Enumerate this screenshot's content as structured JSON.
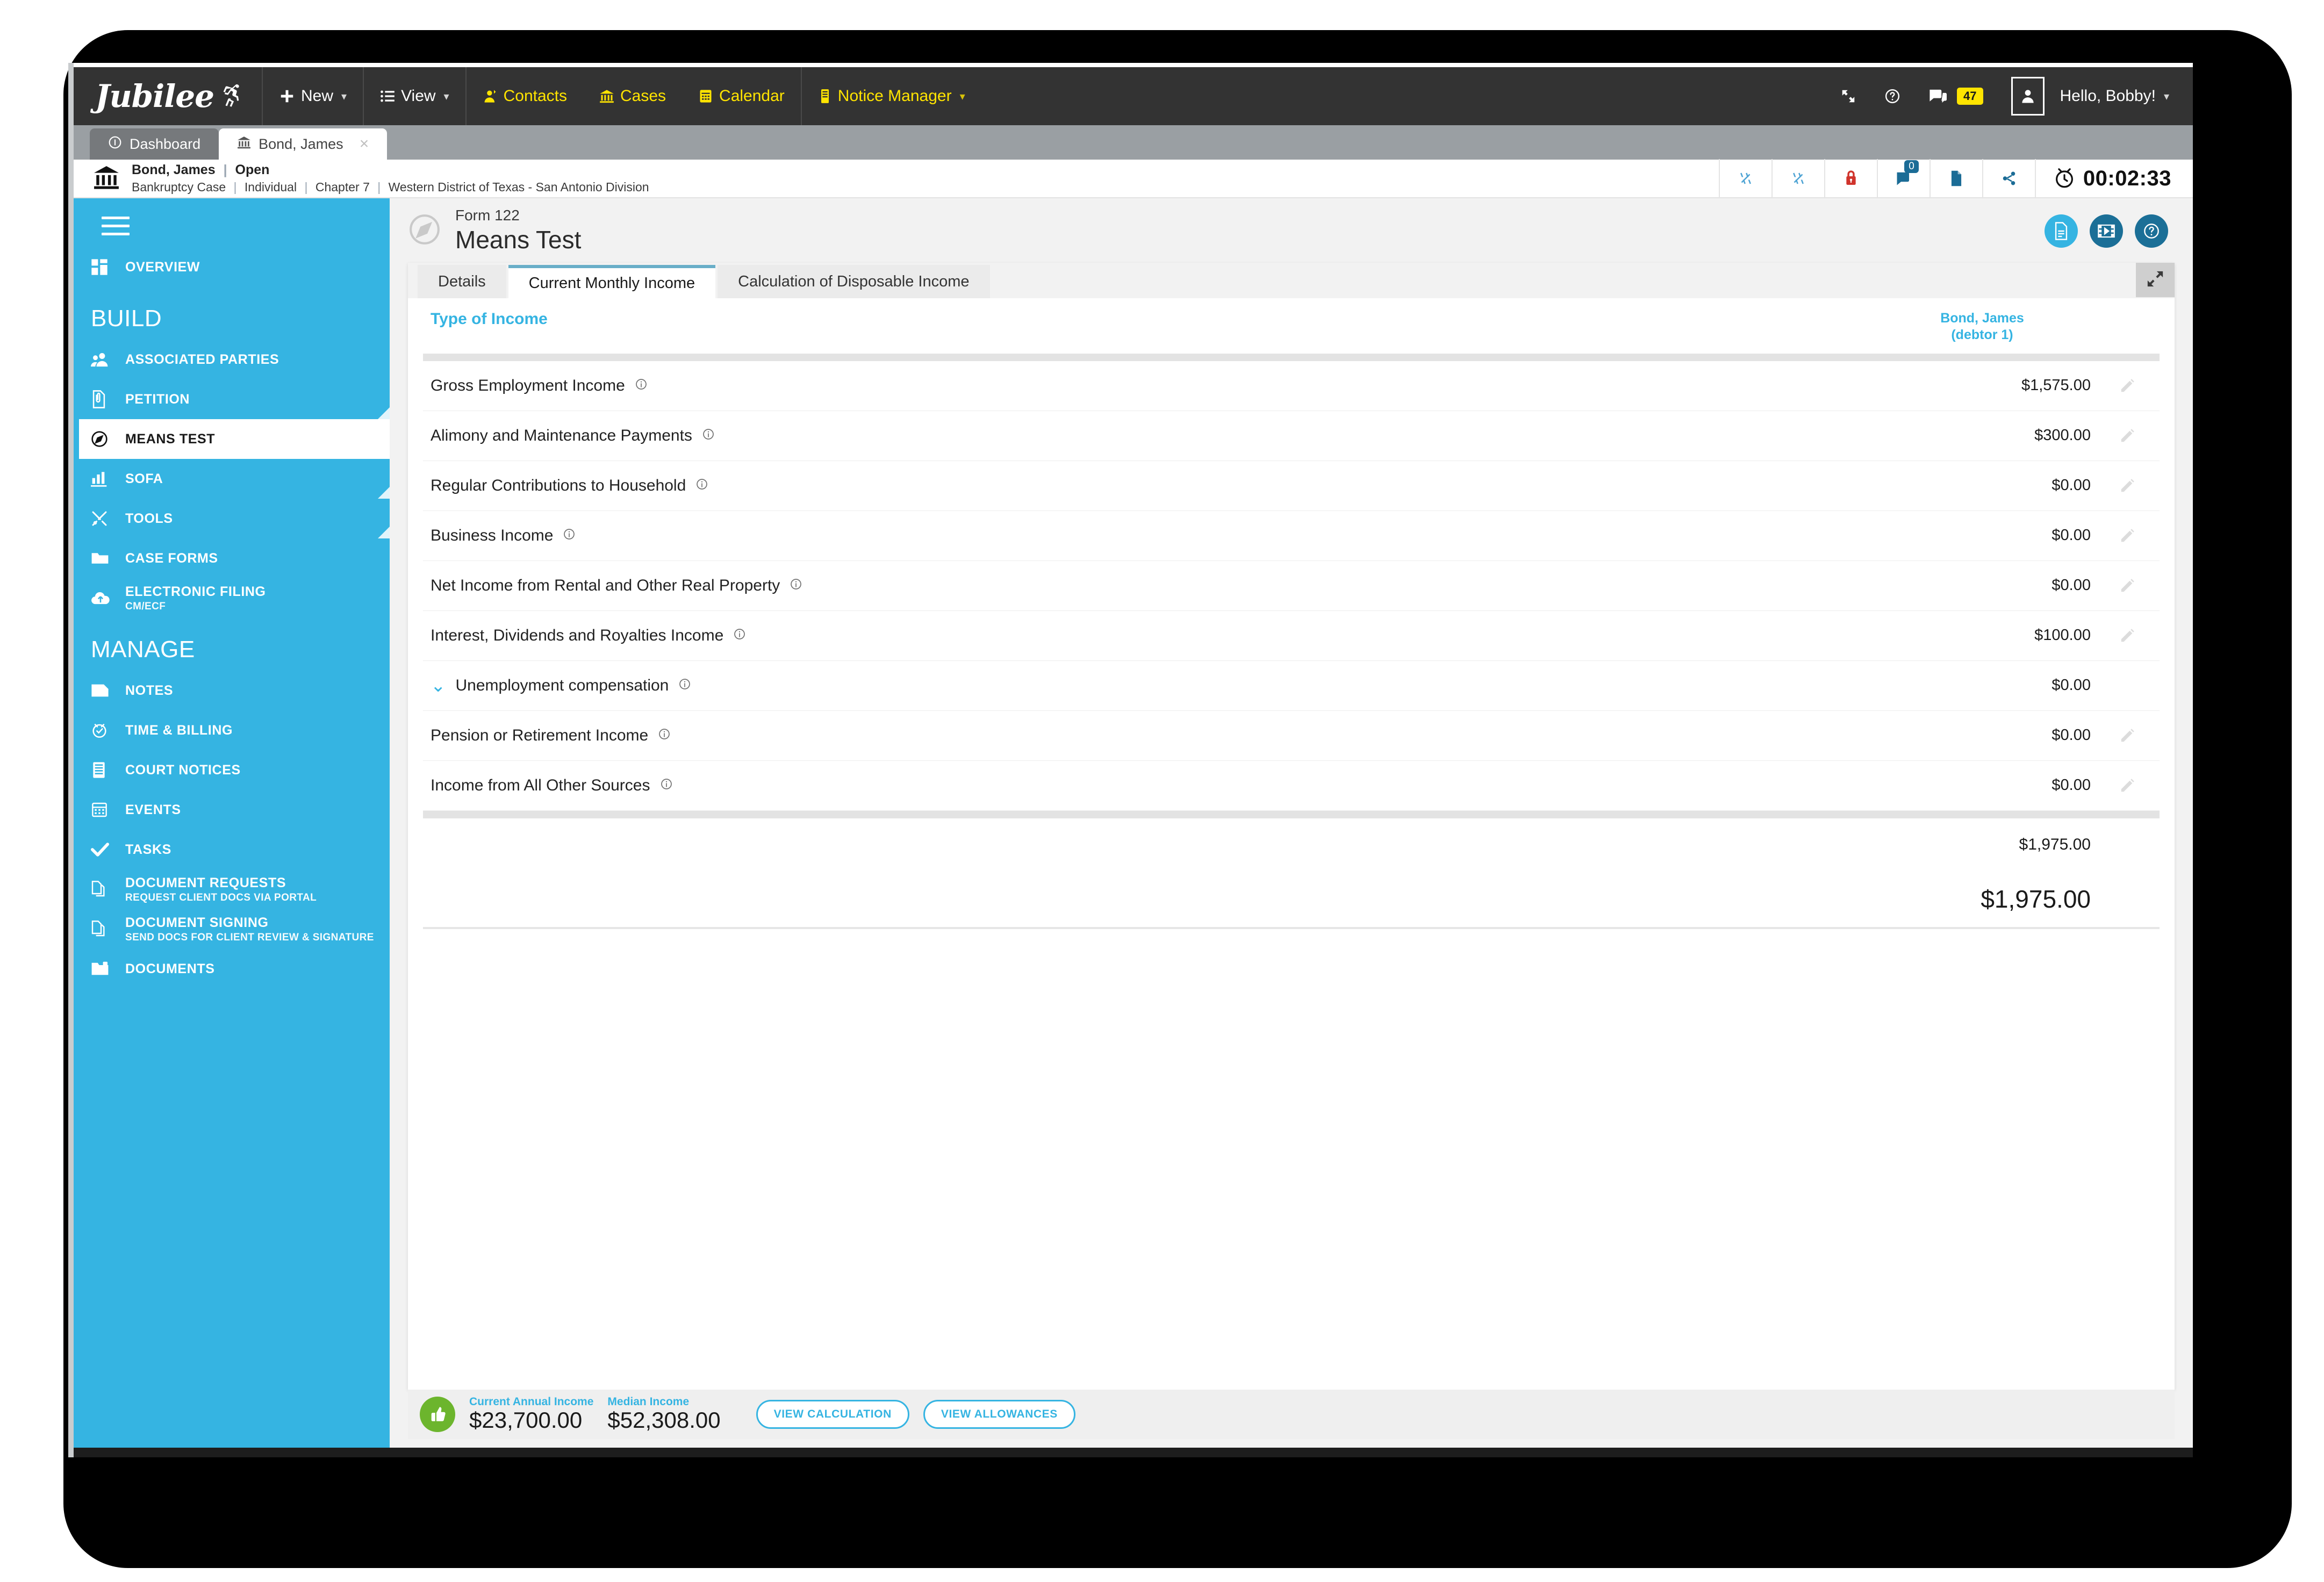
{
  "topnav": {
    "logo": "Jubilee",
    "items": [
      {
        "label": "New",
        "icon": "plus-icon",
        "caret": true
      },
      {
        "label": "View",
        "icon": "list-icon",
        "caret": true
      },
      {
        "label": "Contacts",
        "icon": "contacts-icon",
        "caret": false
      },
      {
        "label": "Cases",
        "icon": "bank-icon",
        "caret": false
      },
      {
        "label": "Calendar",
        "icon": "calendar-icon",
        "caret": false
      },
      {
        "label": "Notice Manager",
        "icon": "notice-icon",
        "caret": true
      }
    ],
    "right": {
      "fullscreen_icon": "fullscreen-icon",
      "help_label": "Help",
      "messages_badge": "47",
      "user_greeting": "Hello, Bobby!"
    }
  },
  "window_tabs": [
    {
      "label": "Dashboard",
      "icon": "info-icon",
      "active": false,
      "closable": false
    },
    {
      "label": "Bond, James",
      "icon": "bank-icon",
      "active": true,
      "closable": true,
      "close": "×"
    }
  ],
  "case_header": {
    "name": "Bond, James",
    "status": "Open",
    "meta": [
      "Bankruptcy Case",
      "Individual",
      "Chapter 7",
      "Western District of Texas - San Antonio Division"
    ],
    "separator": "|",
    "comment_badge": "0",
    "timer": "00:02:33"
  },
  "sidebar": {
    "groups": [
      {
        "title": "",
        "items": [
          {
            "label": "OVERVIEW",
            "sub": "",
            "icon": "grid-icon",
            "active": false,
            "corner": false
          }
        ]
      },
      {
        "title": "BUILD",
        "items": [
          {
            "label": "ASSOCIATED PARTIES",
            "sub": "",
            "icon": "people-icon",
            "active": false,
            "corner": false
          },
          {
            "label": "PETITION",
            "sub": "",
            "icon": "petition-icon",
            "active": false,
            "corner": true
          },
          {
            "label": "MEANS TEST",
            "sub": "",
            "icon": "compass-icon",
            "active": true,
            "corner": false
          },
          {
            "label": "SOFA",
            "sub": "",
            "icon": "bars-icon",
            "active": false,
            "corner": true
          },
          {
            "label": "TOOLS",
            "sub": "",
            "icon": "tools-icon",
            "active": false,
            "corner": true
          },
          {
            "label": "CASE FORMS",
            "sub": "",
            "icon": "folder-icon",
            "active": false,
            "corner": false
          },
          {
            "label": "ELECTRONIC FILING",
            "sub": "CM/ECF",
            "icon": "upload-cloud-icon",
            "active": false,
            "corner": false
          }
        ]
      },
      {
        "title": "MANAGE",
        "items": [
          {
            "label": "NOTES",
            "sub": "",
            "icon": "note-icon",
            "active": false,
            "corner": false
          },
          {
            "label": "TIME & BILLING",
            "sub": "",
            "icon": "clock-icon",
            "active": false,
            "corner": false
          },
          {
            "label": "COURT NOTICES",
            "sub": "",
            "icon": "notices-icon",
            "active": false,
            "corner": false
          },
          {
            "label": "EVENTS",
            "sub": "",
            "icon": "calendar-icon",
            "active": false,
            "corner": false
          },
          {
            "label": "TASKS",
            "sub": "",
            "icon": "check-icon",
            "active": false,
            "corner": false
          },
          {
            "label": "DOCUMENT REQUESTS",
            "sub": "REQUEST CLIENT DOCS VIA PORTAL",
            "icon": "copy-icon",
            "active": false,
            "corner": false
          },
          {
            "label": "DOCUMENT SIGNING",
            "sub": "SEND DOCS FOR CLIENT REVIEW & SIGNATURE",
            "icon": "copy-icon",
            "active": false,
            "corner": false
          },
          {
            "label": "DOCUMENTS",
            "sub": "",
            "icon": "folder-doc-icon",
            "active": false,
            "corner": false
          }
        ]
      }
    ]
  },
  "form": {
    "eyebrow": "Form 122",
    "title": "Means Test",
    "round_buttons": [
      {
        "icon": "document-icon",
        "color": "#35b4e2"
      },
      {
        "icon": "video-icon",
        "color": "#1b6f97"
      },
      {
        "icon": "help-circle-icon",
        "color": "#1b6f97"
      }
    ],
    "tabs": [
      {
        "label": "Details",
        "active": false
      },
      {
        "label": "Current Monthly Income",
        "active": true
      },
      {
        "label": "Calculation of Disposable Income",
        "active": false
      }
    ],
    "expand_icon": "expand-arrows-icon"
  },
  "table": {
    "header_left": "Type of Income",
    "header_right_line1": "Bond, James",
    "header_right_line2": "(debtor 1)",
    "rows": [
      {
        "label": "Gross Employment Income",
        "info": true,
        "value": "$1,575.00",
        "editable": true,
        "chevron": false
      },
      {
        "label": "Alimony and Maintenance Payments",
        "info": true,
        "value": "$300.00",
        "editable": true,
        "chevron": false
      },
      {
        "label": "Regular Contributions to Household",
        "info": true,
        "value": "$0.00",
        "editable": true,
        "chevron": false
      },
      {
        "label": "Business Income",
        "info": true,
        "value": "$0.00",
        "editable": true,
        "chevron": false
      },
      {
        "label": "Net Income from Rental and Other Real Property",
        "info": true,
        "value": "$0.00",
        "editable": true,
        "chevron": false
      },
      {
        "label": "Interest, Dividends and Royalties Income",
        "info": true,
        "value": "$100.00",
        "editable": true,
        "chevron": false
      },
      {
        "label": "Unemployment compensation",
        "info": true,
        "value": "$0.00",
        "editable": false,
        "chevron": true
      },
      {
        "label": "Pension or Retirement Income",
        "info": true,
        "value": "$0.00",
        "editable": true,
        "chevron": false
      },
      {
        "label": "Income from All Other Sources",
        "info": true,
        "value": "$0.00",
        "editable": true,
        "chevron": false
      }
    ],
    "subtotal": "$1,975.00",
    "total": "$1,975.00"
  },
  "footer": {
    "status_icon": "thumbs-up-icon",
    "current_annual_income_label": "Current Annual Income",
    "current_annual_income_value": "$23,700.00",
    "median_income_label": "Median Income",
    "median_income_value": "$52,308.00",
    "view_calculation_label": "VIEW CALCULATION",
    "view_allowances_label": "VIEW ALLOWANCES"
  },
  "colors": {
    "brand_blue": "#35b4e2",
    "nav_dark": "#333333",
    "accent_yellow": "#ffe400",
    "green": "#6cb52d",
    "red": "#d0342c"
  }
}
